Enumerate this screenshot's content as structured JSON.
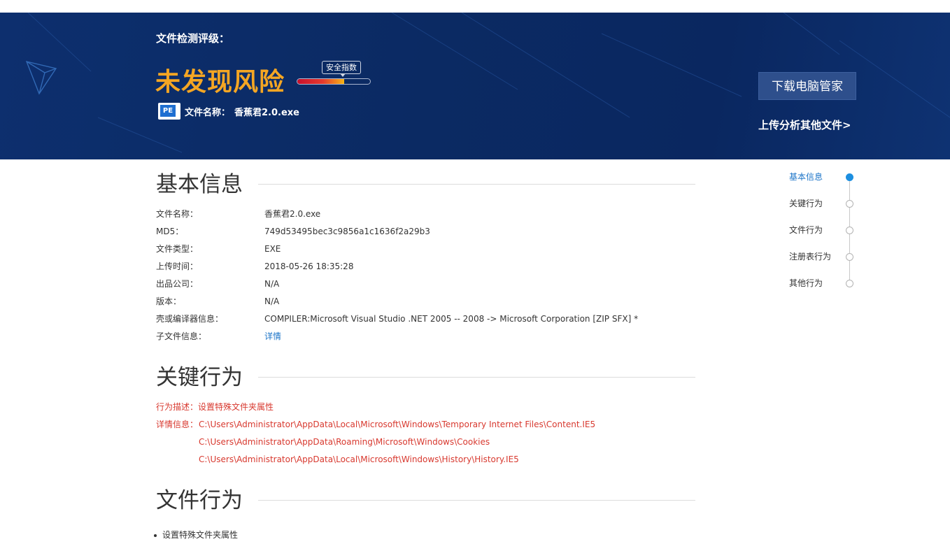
{
  "banner": {
    "rating_label": "文件检测评级：",
    "risk_status": "未发现风险",
    "safety_index_label": "安全指数",
    "safety_index_fraction": 0.64,
    "file_icon_text": "PE",
    "filename_label": "文件名称：",
    "filename_value": "香蕉君2.0.exe",
    "download_button": "下载电脑管家",
    "upload_link": "上传分析其他文件>"
  },
  "basic_info": {
    "title": "基本信息",
    "rows": [
      {
        "label": "文件名称：",
        "value": "香蕉君2.0.exe"
      },
      {
        "label": "MD5：",
        "value": "749d53495bec3c9856a1c1636f2a29b3"
      },
      {
        "label": "文件类型：",
        "value": "EXE"
      },
      {
        "label": "上传时间：",
        "value": "2018-05-26 18:35:28"
      },
      {
        "label": "出品公司：",
        "value": "N/A"
      },
      {
        "label": "版本：",
        "value": "N/A"
      },
      {
        "label": "壳或编译器信息：",
        "value": "COMPILER:Microsoft Visual Studio .NET 2005 -- 2008 -> Microsoft Corporation [ZIP SFX] *"
      },
      {
        "label": "子文件信息：",
        "value": "详情"
      }
    ]
  },
  "key_behavior": {
    "title": "关键行为",
    "desc_label": "行为描述：",
    "desc_value": "设置特殊文件夹属性",
    "detail_label": "详情信息：",
    "details": [
      "C:\\Users\\Administrator\\AppData\\Local\\Microsoft\\Windows\\Temporary Internet Files\\Content.IE5",
      "C:\\Users\\Administrator\\AppData\\Roaming\\Microsoft\\Windows\\Cookies",
      "C:\\Users\\Administrator\\AppData\\Local\\Microsoft\\Windows\\History\\History.IE5"
    ]
  },
  "file_behavior": {
    "title": "文件行为",
    "items": [
      "设置特殊文件夹属性"
    ]
  },
  "side_nav": {
    "items": [
      {
        "label": "基本信息",
        "active": true
      },
      {
        "label": "关键行为",
        "active": false
      },
      {
        "label": "文件行为",
        "active": false
      },
      {
        "label": "注册表行为",
        "active": false
      },
      {
        "label": "其他行为",
        "active": false
      }
    ]
  },
  "colors": {
    "banner_bg": "#0b2a63",
    "risk_text": "#f5a623",
    "link_blue": "#1d75c8",
    "alert_red": "#d8392f",
    "nav_active_dot": "#1d8fe0"
  }
}
